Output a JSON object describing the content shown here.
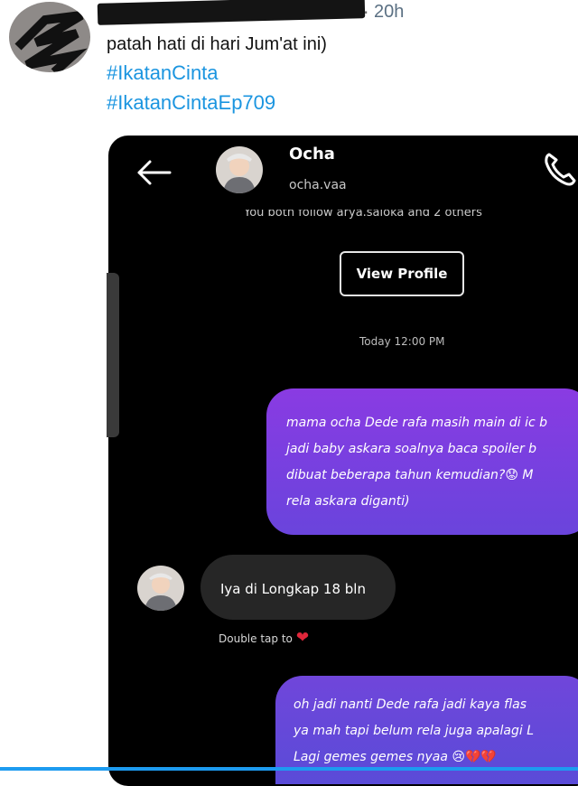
{
  "tweet": {
    "time_dot": "·",
    "time": "20h",
    "text": "patah hati di hari Jum'at ini)",
    "hashtags": [
      "#IkatanCinta",
      "#IkatanCintaEp709"
    ]
  },
  "screenshot": {
    "header": {
      "name": "Ocha",
      "username": "ocha.vaa",
      "follow_line": "You both follow arya.saloka and 2 others"
    },
    "view_profile_label": "View Profile",
    "timestamp": "Today 12:00 PM",
    "messages": {
      "outgoing_1": [
        "mama ocha Dede rafa masih main di ic b",
        "jadi baby askara soalnya baca spoiler b",
        "dibuat beberapa tahun kemudian?",
        "rela askara diganti)"
      ],
      "outgoing_1_tail": "M",
      "incoming_1": "Iya di Longkap 18 bln",
      "double_tap": "Double tap to",
      "outgoing_2": [
        "oh jadi nanti Dede rafa jadi kaya flas",
        "ya mah tapi belum rela juga apalagi L",
        "Lagi gemes gemes nyaa"
      ]
    },
    "emojis": {
      "sad_face": "😟",
      "heart": "❤",
      "crying": "😢",
      "broken_hearts": "💔💔"
    }
  },
  "colors": {
    "hashtag": "#1b95e0",
    "bubble_purple": "#8a3be2",
    "bubble_indigo": "#5a4bd8",
    "incoming_bubble": "#262626"
  }
}
